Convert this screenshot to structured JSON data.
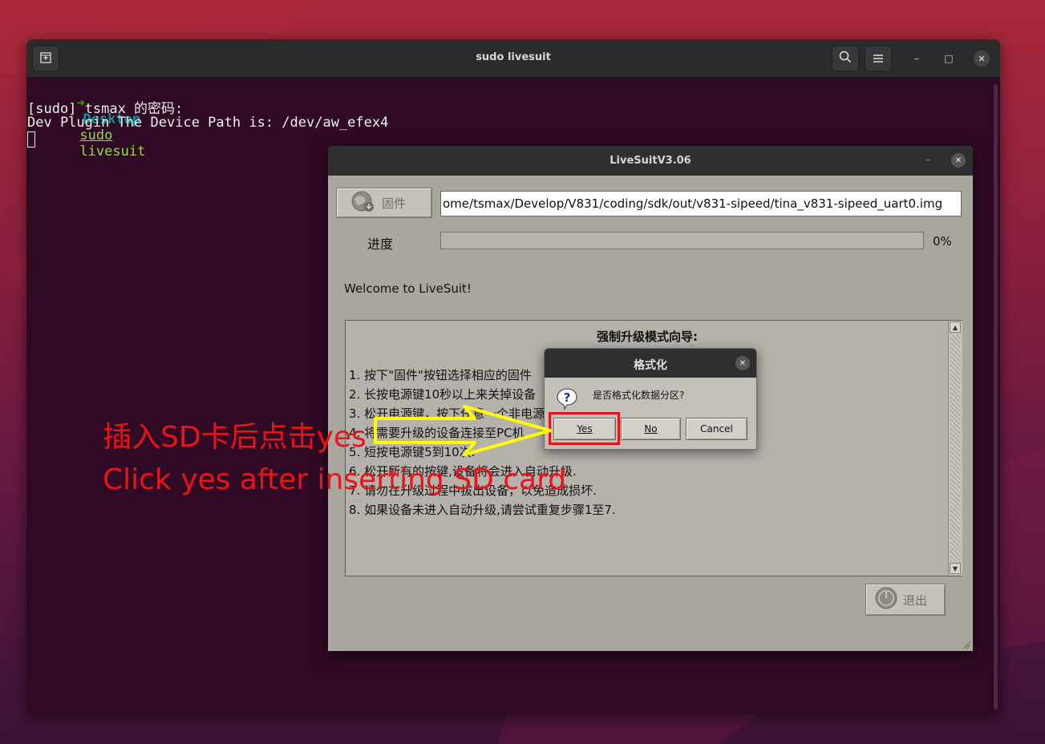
{
  "terminal": {
    "title": "sudo livesuit",
    "prompt_arrow": "➜",
    "prompt_dir": "Desktop",
    "cmd_sudo": "sudo",
    "cmd_rest": "livesuit",
    "line2": "[sudo] tsmax 的密码:",
    "line3": "Dev Plugin The Device Path is: /dev/aw_efex4"
  },
  "livesuit": {
    "title": "LiveSuitV3.06",
    "firmware_button": "固件",
    "firmware_path": "ome/tsmax/Develop/V831/coding/sdk/out/v831-sipeed/tina_v831-sipeed_uart0.img",
    "progress_label": "进度",
    "progress_value": 0,
    "progress_text": "0%",
    "welcome": "Welcome to LiveSuit!",
    "guide_title": "强制升级模式向导:",
    "guide_lines": [
      "1. 按下\"固件\"按钮选择相应的固件",
      "2. 长按电源键10秒以上来关掉设备",
      "3. 松开电源键，按下任意一个非电源",
      "4. 将需要升级的设备连接至PC机",
      "5. 短按电源键5到10次.",
      "6. 松开所有的按键,设备将会进入自动升级.",
      "7. 请勿在升级过程中拔出设备，以免造成损坏.",
      "8. 如果设备未进入自动升级,请尝试重复步骤1至7."
    ],
    "exit_button": "退出"
  },
  "dialog": {
    "title": "格式化",
    "message": "是否格式化数据分区?",
    "yes": "Yes",
    "no": "No",
    "cancel": "Cancel"
  },
  "annotation": {
    "zh": "插入SD卡后点击yes",
    "en": "Click yes after inserting SD card",
    "color": "#e8141b",
    "arrow_color": "#ffff00"
  },
  "icons": {
    "new_tab": "new-tab-icon",
    "search": "search-icon",
    "menu": "hamburger-menu-icon",
    "question": "question-icon"
  }
}
